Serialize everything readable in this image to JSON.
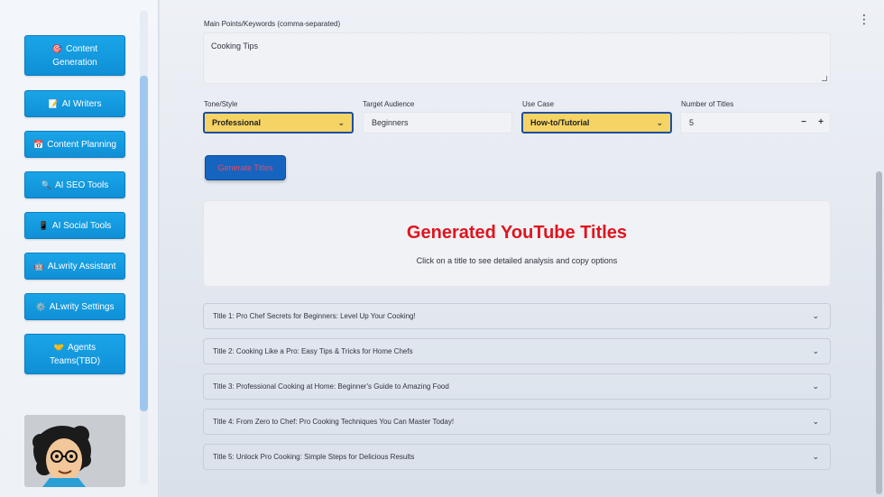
{
  "sidebar": {
    "items": [
      {
        "icon": "🎯",
        "label": "Content Generation"
      },
      {
        "icon": "📝",
        "label": "AI Writers"
      },
      {
        "icon": "📅",
        "label": "Content Planning"
      },
      {
        "icon": "🔍",
        "label": "AI SEO Tools"
      },
      {
        "icon": "📱",
        "label": "AI Social Tools"
      },
      {
        "icon": "🤖",
        "label": "ALwrity Assistant"
      },
      {
        "icon": "⚙️",
        "label": "ALwrity Settings"
      },
      {
        "icon": "🤝",
        "label": "Agents Teams(TBD)"
      }
    ]
  },
  "form": {
    "keywords_label": "Main Points/Keywords (comma-separated)",
    "keywords_value": "Cooking Tips",
    "tone_label": "Tone/Style",
    "tone_value": "Professional",
    "audience_label": "Target Audience",
    "audience_value": "Beginners",
    "usecase_label": "Use Case",
    "usecase_value": "How-to/Tutorial",
    "num_label": "Number of Titles",
    "num_value": "5",
    "minus": "−",
    "plus": "+",
    "generate_label": "Generate Titles"
  },
  "results": {
    "heading": "Generated YouTube Titles",
    "subtext": "Click on a title to see detailed analysis and copy options",
    "titles": [
      "Title 1: Pro Chef Secrets for Beginners: Level Up Your Cooking!",
      "Title 2: Cooking Like a Pro: Easy Tips & Tricks for Home Chefs",
      "Title 3: Professional Cooking at Home: Beginner's Guide to Amazing Food",
      "Title 4: From Zero to Chef: Pro Cooking Techniques You Can Master Today!",
      "Title 5: Unlock Pro Cooking: Simple Steps for Delicious Results"
    ]
  },
  "colors": {
    "accent_blue": "#1565c0",
    "nav_blue": "#1aa5e8",
    "select_yellow": "#f5d465",
    "heading_red": "#e0141e"
  }
}
